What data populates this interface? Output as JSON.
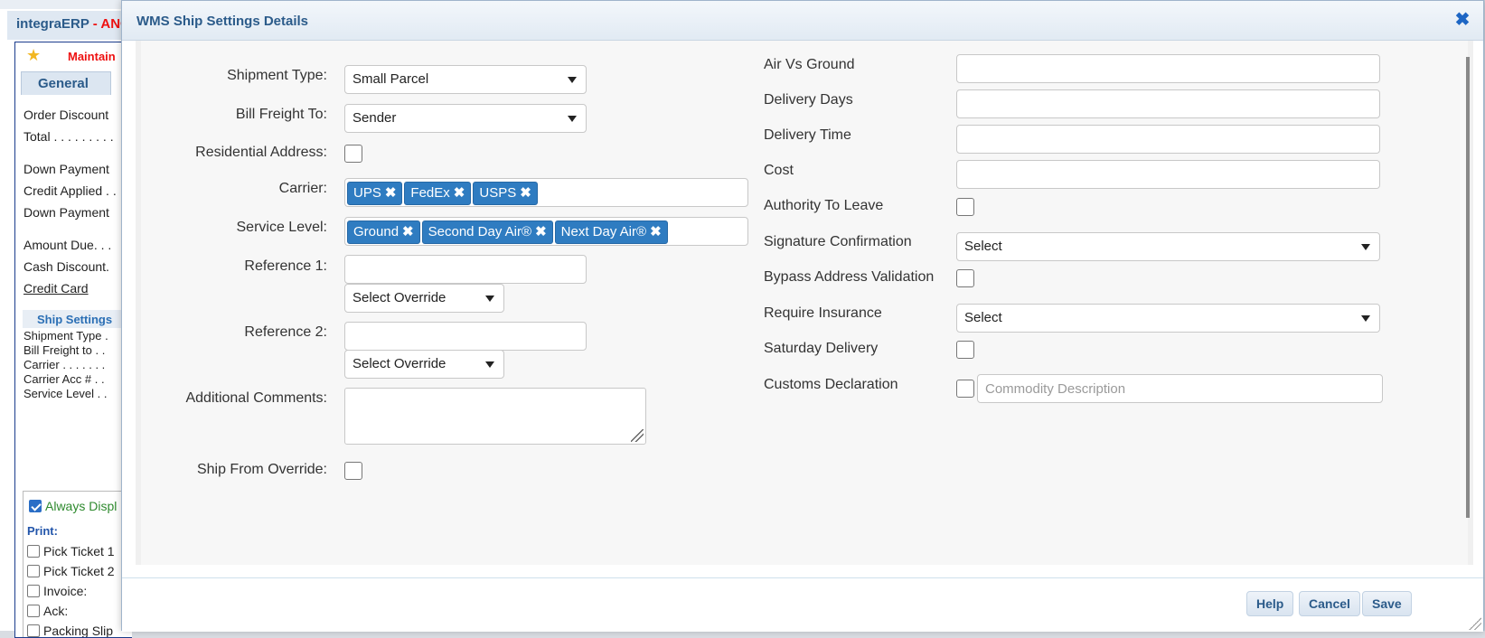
{
  "background": {
    "app_title": "integraERP",
    "app_title_suffix": "- ANO",
    "maintain_label": "Maintain",
    "tab_general": "General",
    "rows": [
      "Order Discount",
      "Total . . . . . . . . .",
      "Down Payment",
      "Credit Applied . .",
      "Down Payment",
      "Amount Due. . .",
      "Cash Discount.",
      "Credit Card"
    ],
    "ship_settings_title": "Ship Settings",
    "ship_rows": [
      "Shipment Type .",
      "Bill Freight to . .",
      "Carrier . . . . . . .",
      "Carrier Acc # . .",
      "Service Level . ."
    ],
    "always_display": "Always Displ",
    "print_label": "Print:",
    "print_items": [
      "Pick Ticket 1",
      "Pick Ticket 2",
      "Invoice:",
      "Ack:",
      "Packing Slip"
    ]
  },
  "modal": {
    "title": "WMS Ship Settings Details",
    "close_icon": "close-icon"
  },
  "left_form": {
    "shipment_type": {
      "label": "Shipment Type:",
      "value": "Small Parcel"
    },
    "bill_freight_to": {
      "label": "Bill Freight To:",
      "value": "Sender"
    },
    "residential_address": {
      "label": "Residential Address:"
    },
    "carrier": {
      "label": "Carrier:",
      "tags": [
        "UPS",
        "FedEx",
        "USPS"
      ]
    },
    "service_level": {
      "label": "Service Level:",
      "tags": [
        "Ground",
        "Second Day Air®",
        "Next Day Air®"
      ]
    },
    "reference1": {
      "label": "Reference 1:",
      "value": "",
      "override": "Select Override"
    },
    "reference2": {
      "label": "Reference 2:",
      "value": "",
      "override": "Select Override"
    },
    "additional_comments": {
      "label": "Additional Comments:",
      "value": ""
    },
    "ship_from_override": {
      "label": "Ship From Override:"
    }
  },
  "right_form": {
    "air_vs_ground": {
      "label": "Air Vs Ground",
      "value": ""
    },
    "delivery_days": {
      "label": "Delivery Days",
      "value": ""
    },
    "delivery_time": {
      "label": "Delivery Time",
      "value": ""
    },
    "cost": {
      "label": "Cost",
      "value": ""
    },
    "authority_to_leave": {
      "label": "Authority To Leave"
    },
    "signature_confirmation": {
      "label": "Signature Confirmation",
      "value": "Select"
    },
    "bypass_address_validation": {
      "label": "Bypass Address Validation"
    },
    "require_insurance": {
      "label": "Require Insurance",
      "value": "Select"
    },
    "saturday_delivery": {
      "label": "Saturday Delivery"
    },
    "customs_declaration": {
      "label": "Customs Declaration",
      "placeholder": "Commodity Description"
    }
  },
  "footer": {
    "help": "Help",
    "cancel": "Cancel",
    "save": "Save"
  }
}
